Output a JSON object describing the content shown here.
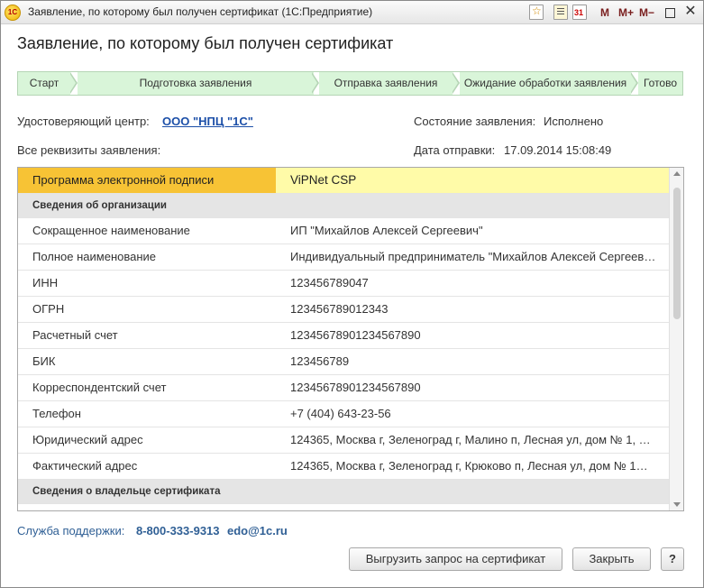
{
  "window": {
    "title": "Заявление, по которому был получен сертификат  (1С:Предприятие)",
    "logo_text": "1С",
    "toolbar": {
      "mem_m": "M",
      "mem_plus": "M+",
      "mem_minus": "M−",
      "close": "✕"
    }
  },
  "page_title": "Заявление, по которому был получен сертификат",
  "steps": [
    {
      "label": "Старт",
      "state": "done"
    },
    {
      "label": "Подготовка заявления",
      "state": "done"
    },
    {
      "label": "Отправка заявления",
      "state": "done"
    },
    {
      "label": "Ожидание обработки заявления",
      "state": "done"
    },
    {
      "label": "Готово",
      "state": "done"
    }
  ],
  "info": {
    "ca_label": "Удостоверяющий центр:",
    "ca_value": "ООО \"НПЦ \"1С\"",
    "status_label": "Состояние заявления:",
    "status_value": "Исполнено",
    "requisites_label": "Все реквизиты заявления:",
    "sent_label": "Дата отправки:",
    "sent_value": "17.09.2014 15:08:49"
  },
  "table": {
    "rows": [
      {
        "type": "selected",
        "name": "Программа электронной подписи",
        "value": "ViPNet CSP"
      },
      {
        "type": "section",
        "name": "Сведения об организации",
        "value": ""
      },
      {
        "type": "row",
        "name": "Сокращенное наименование",
        "value": "ИП \"Михайлов Алексей Сергеевич\""
      },
      {
        "type": "row",
        "name": "Полное наименование",
        "value": "Индивидуальный предприниматель \"Михайлов Алексей Сергеев…"
      },
      {
        "type": "row",
        "name": "ИНН",
        "value": "123456789047"
      },
      {
        "type": "row",
        "name": "ОГРН",
        "value": "123456789012343"
      },
      {
        "type": "row",
        "name": "Расчетный счет",
        "value": "12345678901234567890"
      },
      {
        "type": "row",
        "name": "БИК",
        "value": "123456789"
      },
      {
        "type": "row",
        "name": "Корреспондентский счет",
        "value": "12345678901234567890"
      },
      {
        "type": "row",
        "name": "Телефон",
        "value": "+7 (404) 643-23-56"
      },
      {
        "type": "row",
        "name": "Юридический адрес",
        "value": "124365, Москва г, Зеленоград г, Малино п, Лесная ул, дом № 1, …"
      },
      {
        "type": "row",
        "name": "Фактический адрес",
        "value": "124365, Москва г, Зеленоград г, Крюково п, Лесная ул, дом № 1…"
      },
      {
        "type": "section",
        "name": "Сведения о владельце сертификата",
        "value": ""
      }
    ]
  },
  "footer": {
    "support_label": "Служба поддержки:",
    "support_phone": "8-800-333-9313",
    "support_email": "edo@1c.ru",
    "upload_button": "Выгрузить запрос на сертификат",
    "close_button": "Закрыть",
    "help_button": "?"
  },
  "colors": {
    "step_done": "#d9f5d9",
    "selected_name_bg": "#f7c335",
    "selected_value_bg": "#fffba8",
    "section_bg": "#e5e5e5",
    "link": "#1c4fa8"
  }
}
